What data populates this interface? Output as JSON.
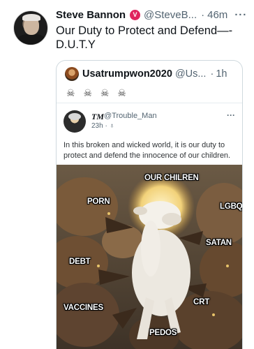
{
  "tweet": {
    "author_name": "Steve Bannon",
    "verified_glyph": "V",
    "handle": "@SteveB...",
    "separator": "·",
    "time": "46m",
    "more": "···",
    "text": "Our Duty to Protect and Defend—- D.U.T.Y"
  },
  "quote": {
    "author_name": "Usatrumpwon2020",
    "handle": "@Us...",
    "separator": "·",
    "time": "1h",
    "emojis": "☠ ☠ ☠ ☠",
    "inner": {
      "author_name": "TM",
      "handle": "@Trouble_Man",
      "time": "23h · ♁",
      "more": "···",
      "text": "In this broken and wicked world, it is our duty to protect and defend the innocence of our children.",
      "meme_labels": {
        "children": "OUR CHILREN",
        "porn": "PORN",
        "lgbq": "LGBQ",
        "satan": "SATAN",
        "debt": "DEBT",
        "crt": "CRT",
        "vaccines": "VACCINES",
        "pedos": "PEDOS"
      }
    }
  },
  "colors": {
    "verified": "#e0245e",
    "secondary_text": "#536471",
    "border": "#cfd9de"
  }
}
